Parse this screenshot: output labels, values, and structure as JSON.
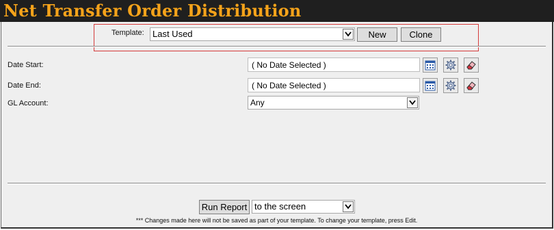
{
  "app": {
    "title": "Net Transfer Order Distribution"
  },
  "template": {
    "label": "Template:",
    "selected": "Last Used",
    "new_button": "New",
    "clone_button": "Clone"
  },
  "fields": {
    "date_start": {
      "label": "Date Start:",
      "value": "( No Date Selected )"
    },
    "date_end": {
      "label": "Date End:",
      "value": "( No Date Selected )"
    },
    "gl_account": {
      "label": "GL Account:",
      "selected": "Any"
    }
  },
  "footer": {
    "run_button": "Run Report",
    "output_selected": "to the screen",
    "note": "*** Changes made here will not be saved as part of your template. To change your template, press Edit."
  },
  "icons": {
    "calendar": "calendar-icon",
    "settings": "gear-icon",
    "clear": "eraser-icon",
    "dropdown": "chevron-down-icon"
  },
  "colors": {
    "title_bar": "#1f1f1f",
    "title_text": "#f5a31a",
    "panel": "#efefef",
    "template_frame": "#d43a3a"
  }
}
